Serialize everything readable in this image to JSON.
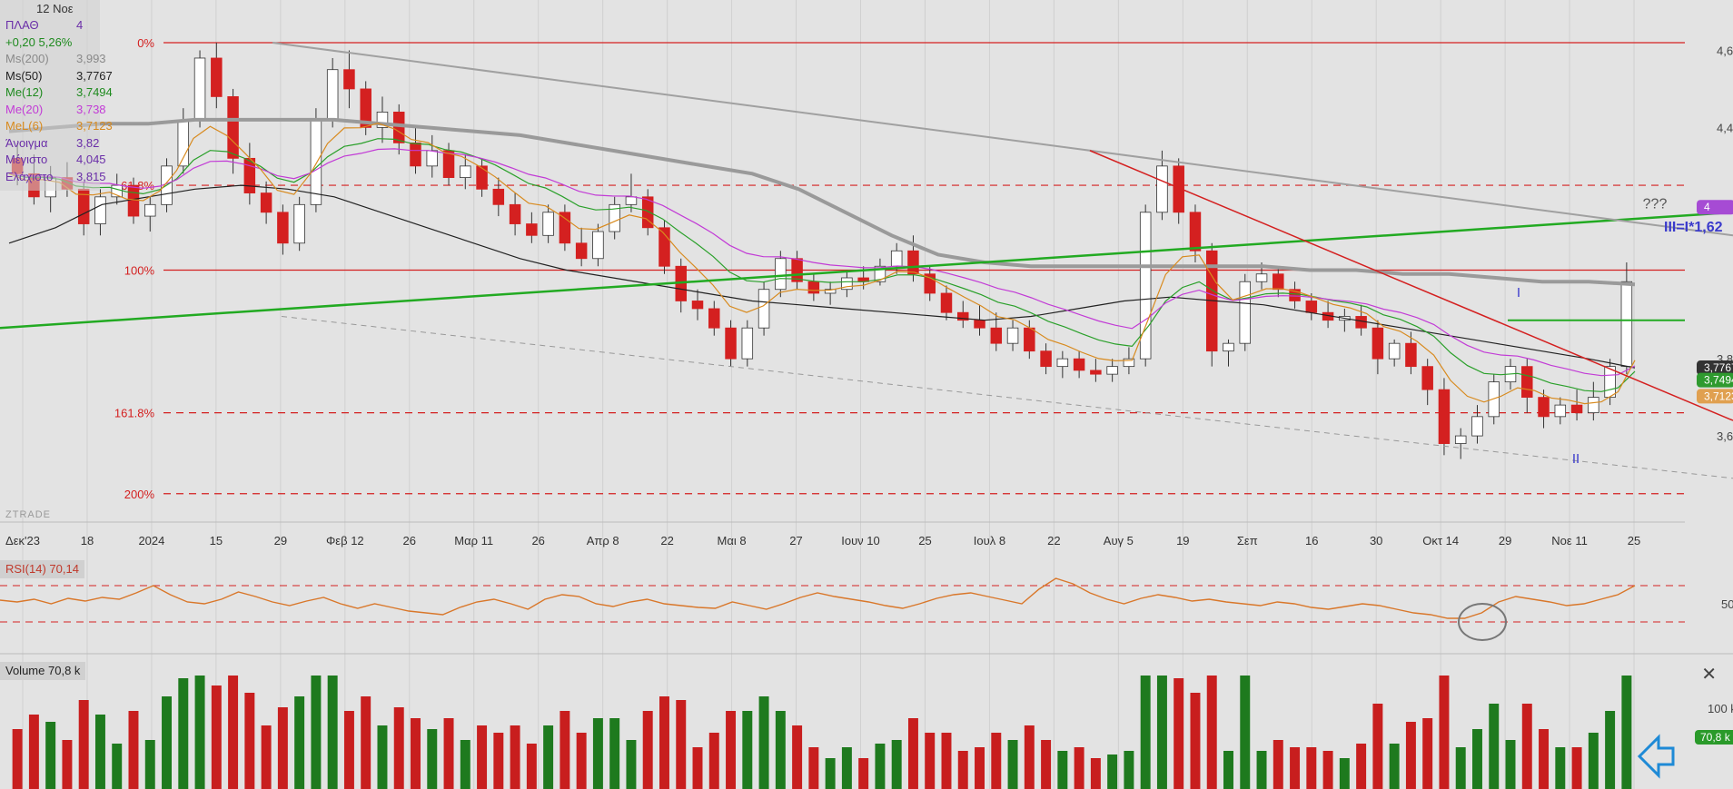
{
  "hud": {
    "date": "12 Νοε",
    "rows": [
      {
        "label": "ΠΛΑΘ",
        "value": "4",
        "color": "#6a2ea8"
      },
      {
        "label": "+0,20 5,26%",
        "value": "",
        "color": "#1e8a1e"
      },
      {
        "label": "Ms(200)",
        "value": "3,993",
        "color": "#8a8a8a"
      },
      {
        "label": "Ms(50)",
        "value": "3,7767",
        "color": "#222222"
      },
      {
        "label": "Me(12)",
        "value": "3,7494",
        "color": "#1e8a1e"
      },
      {
        "label": "Me(20)",
        "value": "3,738",
        "color": "#c23bd6"
      },
      {
        "label": "MeL(6)",
        "value": "3,7123",
        "color": "#d88a1e"
      },
      {
        "label": "Άνοιγμα",
        "value": "3,82",
        "color": "#6a2ea8"
      },
      {
        "label": "Μέγιστο",
        "value": "4,045",
        "color": "#6a2ea8"
      },
      {
        "label": "Ελάχιστο",
        "value": "3,815",
        "color": "#6a2ea8"
      }
    ]
  },
  "brand": "ZTRADE",
  "price_axis": {
    "labels": [
      "4,6",
      "4,4",
      "4,2",
      "3,8",
      "3,6"
    ]
  },
  "price_badges": [
    {
      "text": "4",
      "color": "#a64bd4"
    },
    {
      "text": "3,7767",
      "color": "#333333"
    },
    {
      "text": "3,7494",
      "color": "#2f9a2f"
    },
    {
      "text": "3,7123",
      "color": "#e0a050"
    }
  ],
  "fib_levels": [
    {
      "label": "0%",
      "price": 4.62,
      "style": "solid"
    },
    {
      "label": "61.8%",
      "price": 4.25,
      "style": "dashed"
    },
    {
      "label": "100%",
      "price": 4.03,
      "style": "solid"
    },
    {
      "label": "161.8%",
      "price": 3.66,
      "style": "dashed"
    },
    {
      "label": "200%",
      "price": 3.45,
      "style": "dashed"
    }
  ],
  "annotations": {
    "wave_I": "I",
    "wave_II": "II",
    "wave_III": "III=I*1,62",
    "question": "???"
  },
  "x_axis": {
    "labels": [
      "Δεκ'23",
      "18",
      "2024",
      "15",
      "29",
      "Φεβ 12",
      "26",
      "Μαρ 11",
      "26",
      "Απρ 8",
      "22",
      "Μαι 8",
      "27",
      "Ιουν 10",
      "25",
      "Ιουλ 8",
      "22",
      "Αυγ 5",
      "19",
      "Σεπ",
      "16",
      "30",
      "Οκτ 14",
      "29",
      "Νοε 11",
      "25"
    ]
  },
  "rsi": {
    "label": "RSI(14)",
    "value": "70,14",
    "axis_label": "50",
    "upper": 70,
    "lower": 30
  },
  "volume": {
    "label": "Volume",
    "value": "70,8 k",
    "axis_label": "100 k",
    "badge": "70,8 k"
  },
  "colors": {
    "up": "#ffffff",
    "down": "#d42020",
    "fib": "#d42020",
    "ms200": "#9a9a9a",
    "ms50": "#222222",
    "me12": "#2aa02a",
    "me20": "#c23bd6",
    "mel6": "#d88a1e",
    "trend_green": "#22aa22",
    "rsi": "#d9772a",
    "vol_up": "#1e7a1e",
    "vol_down": "#c81e1e"
  },
  "chart_data": {
    "type": "candlestick",
    "ylim": [
      3.4,
      4.66
    ],
    "candles": [
      [
        4.32,
        4.36,
        4.25,
        4.28
      ],
      [
        4.28,
        4.33,
        4.2,
        4.22
      ],
      [
        4.22,
        4.3,
        4.18,
        4.27
      ],
      [
        4.27,
        4.31,
        4.22,
        4.24
      ],
      [
        4.24,
        4.26,
        4.12,
        4.15
      ],
      [
        4.15,
        4.24,
        4.12,
        4.22
      ],
      [
        4.22,
        4.28,
        4.2,
        4.25
      ],
      [
        4.25,
        4.27,
        4.15,
        4.17
      ],
      [
        4.17,
        4.22,
        4.13,
        4.2
      ],
      [
        4.2,
        4.32,
        4.18,
        4.3
      ],
      [
        4.3,
        4.45,
        4.28,
        4.42
      ],
      [
        4.42,
        4.6,
        4.4,
        4.58
      ],
      [
        4.58,
        4.62,
        4.45,
        4.48
      ],
      [
        4.48,
        4.5,
        4.28,
        4.32
      ],
      [
        4.32,
        4.36,
        4.2,
        4.23
      ],
      [
        4.23,
        4.26,
        4.15,
        4.18
      ],
      [
        4.18,
        4.2,
        4.07,
        4.1
      ],
      [
        4.1,
        4.22,
        4.08,
        4.2
      ],
      [
        4.2,
        4.45,
        4.18,
        4.42
      ],
      [
        4.42,
        4.58,
        4.4,
        4.55
      ],
      [
        4.55,
        4.6,
        4.45,
        4.5
      ],
      [
        4.5,
        4.52,
        4.38,
        4.4
      ],
      [
        4.4,
        4.48,
        4.36,
        4.44
      ],
      [
        4.44,
        4.46,
        4.33,
        4.36
      ],
      [
        4.36,
        4.4,
        4.28,
        4.3
      ],
      [
        4.3,
        4.38,
        4.27,
        4.34
      ],
      [
        4.34,
        4.36,
        4.25,
        4.27
      ],
      [
        4.27,
        4.33,
        4.24,
        4.3
      ],
      [
        4.3,
        4.32,
        4.22,
        4.24
      ],
      [
        4.24,
        4.27,
        4.17,
        4.2
      ],
      [
        4.2,
        4.23,
        4.12,
        4.15
      ],
      [
        4.15,
        4.18,
        4.1,
        4.12
      ],
      [
        4.12,
        4.2,
        4.1,
        4.18
      ],
      [
        4.18,
        4.2,
        4.08,
        4.1
      ],
      [
        4.1,
        4.14,
        4.04,
        4.06
      ],
      [
        4.06,
        4.15,
        4.04,
        4.13
      ],
      [
        4.13,
        4.22,
        4.11,
        4.2
      ],
      [
        4.2,
        4.28,
        4.18,
        4.22
      ],
      [
        4.22,
        4.24,
        4.12,
        4.14
      ],
      [
        4.14,
        4.16,
        4.02,
        4.04
      ],
      [
        4.04,
        4.06,
        3.92,
        3.95
      ],
      [
        3.95,
        3.98,
        3.9,
        3.93
      ],
      [
        3.93,
        3.95,
        3.86,
        3.88
      ],
      [
        3.88,
        3.9,
        3.78,
        3.8
      ],
      [
        3.8,
        3.9,
        3.78,
        3.88
      ],
      [
        3.88,
        4.0,
        3.86,
        3.98
      ],
      [
        3.98,
        4.08,
        3.96,
        4.06
      ],
      [
        4.06,
        4.08,
        3.98,
        4.0
      ],
      [
        4.0,
        4.02,
        3.95,
        3.97
      ],
      [
        3.97,
        4.0,
        3.94,
        3.98
      ],
      [
        3.98,
        4.03,
        3.96,
        4.01
      ],
      [
        4.01,
        4.04,
        3.98,
        4.0
      ],
      [
        4.0,
        4.06,
        3.99,
        4.04
      ],
      [
        4.04,
        4.1,
        4.02,
        4.08
      ],
      [
        4.08,
        4.12,
        4.0,
        4.02
      ],
      [
        4.02,
        4.04,
        3.95,
        3.97
      ],
      [
        3.97,
        3.99,
        3.9,
        3.92
      ],
      [
        3.92,
        3.95,
        3.88,
        3.9
      ],
      [
        3.9,
        3.94,
        3.86,
        3.88
      ],
      [
        3.88,
        3.92,
        3.82,
        3.84
      ],
      [
        3.84,
        3.9,
        3.82,
        3.88
      ],
      [
        3.88,
        3.9,
        3.8,
        3.82
      ],
      [
        3.82,
        3.84,
        3.76,
        3.78
      ],
      [
        3.78,
        3.82,
        3.75,
        3.8
      ],
      [
        3.8,
        3.82,
        3.75,
        3.77
      ],
      [
        3.77,
        3.8,
        3.74,
        3.76
      ],
      [
        3.76,
        3.8,
        3.74,
        3.78
      ],
      [
        3.78,
        3.83,
        3.76,
        3.8
      ],
      [
        3.8,
        4.2,
        3.78,
        4.18
      ],
      [
        4.18,
        4.34,
        4.16,
        4.3
      ],
      [
        4.3,
        4.32,
        4.15,
        4.18
      ],
      [
        4.18,
        4.2,
        4.05,
        4.08
      ],
      [
        4.08,
        4.1,
        3.78,
        3.82
      ],
      [
        3.82,
        3.85,
        3.78,
        3.84
      ],
      [
        3.84,
        4.02,
        3.82,
        4.0
      ],
      [
        4.0,
        4.05,
        3.98,
        4.02
      ],
      [
        4.02,
        4.04,
        3.96,
        3.98
      ],
      [
        3.98,
        4.0,
        3.93,
        3.95
      ],
      [
        3.95,
        3.97,
        3.9,
        3.92
      ],
      [
        3.92,
        3.95,
        3.88,
        3.9
      ],
      [
        3.9,
        3.93,
        3.87,
        3.91
      ],
      [
        3.91,
        3.94,
        3.86,
        3.88
      ],
      [
        3.88,
        3.9,
        3.76,
        3.8
      ],
      [
        3.8,
        3.85,
        3.78,
        3.84
      ],
      [
        3.84,
        3.87,
        3.76,
        3.78
      ],
      [
        3.78,
        3.8,
        3.68,
        3.72
      ],
      [
        3.72,
        3.75,
        3.55,
        3.58
      ],
      [
        3.58,
        3.62,
        3.54,
        3.6
      ],
      [
        3.6,
        3.68,
        3.58,
        3.65
      ],
      [
        3.65,
        3.76,
        3.63,
        3.74
      ],
      [
        3.74,
        3.8,
        3.72,
        3.78
      ],
      [
        3.78,
        3.8,
        3.66,
        3.7
      ],
      [
        3.7,
        3.72,
        3.62,
        3.65
      ],
      [
        3.65,
        3.7,
        3.63,
        3.68
      ],
      [
        3.68,
        3.72,
        3.64,
        3.66
      ],
      [
        3.66,
        3.74,
        3.64,
        3.7
      ],
      [
        3.7,
        3.8,
        3.68,
        3.78
      ],
      [
        3.78,
        4.05,
        3.76,
        4.0
      ]
    ],
    "series_ms200": [
      4.39,
      4.4,
      4.41,
      4.41,
      4.42,
      4.42,
      4.42,
      4.42,
      4.41,
      4.4,
      4.39,
      4.38,
      4.36,
      4.34,
      4.32,
      4.3,
      4.28,
      4.24,
      4.18,
      4.12,
      4.07,
      4.05,
      4.04,
      4.04,
      4.04,
      4.04,
      4.04,
      4.04,
      4.03,
      4.03,
      4.02,
      4.02,
      4.01,
      4.0,
      4.0,
      3.993
    ],
    "series_ms50": [
      4.1,
      4.14,
      4.2,
      4.22,
      4.24,
      4.25,
      4.24,
      4.22,
      4.18,
      4.14,
      4.1,
      4.06,
      4.03,
      4.01,
      3.99,
      3.97,
      3.95,
      3.94,
      3.93,
      3.92,
      3.91,
      3.9,
      3.91,
      3.93,
      3.95,
      3.96,
      3.95,
      3.94,
      3.92,
      3.9,
      3.88,
      3.86,
      3.84,
      3.82,
      3.8,
      3.7767
    ],
    "rsi_values": [
      54,
      52,
      55,
      50,
      56,
      53,
      57,
      55,
      62,
      70,
      60,
      52,
      50,
      55,
      63,
      58,
      52,
      48,
      53,
      57,
      50,
      45,
      50,
      46,
      42,
      40,
      38,
      46,
      52,
      55,
      50,
      44,
      55,
      60,
      58,
      50,
      47,
      52,
      55,
      50,
      48,
      46,
      45,
      52,
      48,
      44,
      50,
      57,
      62,
      58,
      55,
      52,
      48,
      45,
      50,
      56,
      60,
      62,
      58,
      54,
      50,
      66,
      78,
      72,
      62,
      55,
      50,
      56,
      60,
      57,
      53,
      55,
      52,
      50,
      48,
      52,
      50,
      46,
      44,
      47,
      50,
      48,
      44,
      40,
      38,
      34,
      34,
      40,
      52,
      58,
      55,
      52,
      48,
      50,
      55,
      60,
      70
    ]
  }
}
